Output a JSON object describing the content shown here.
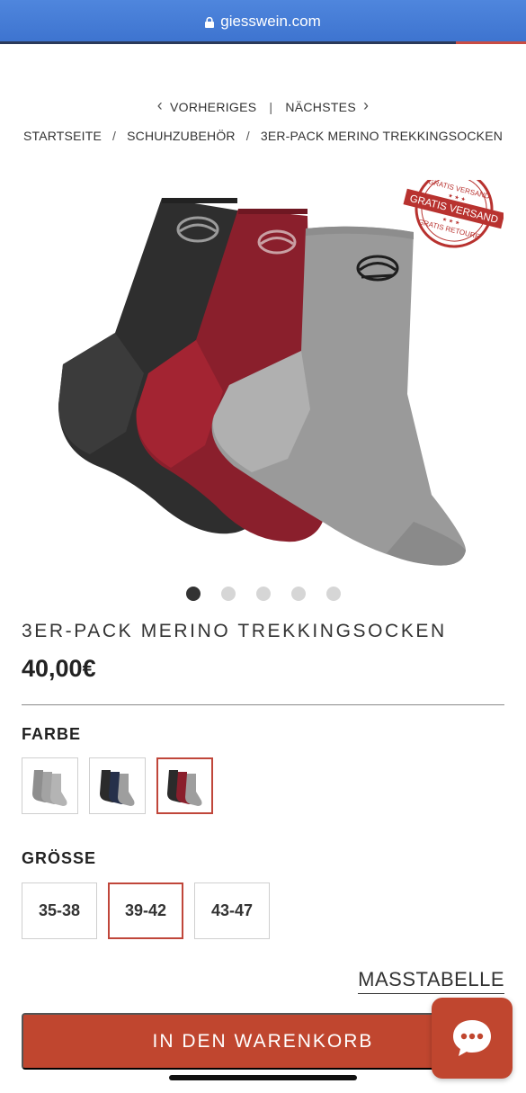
{
  "browser": {
    "url": "giesswein.com"
  },
  "nav": {
    "prev_label": "VORHERIGES",
    "separator": "|",
    "next_label": "NÄCHSTES"
  },
  "breadcrumb": {
    "items": [
      "STARTSEITE",
      "SCHUHZUBEHÖR",
      "3ER-PACK MERINO TREKKINGSOCKEN"
    ],
    "separator": "/"
  },
  "badge": {
    "top_text": "GRATIS VERSAND",
    "band_text": "GRATIS VERSAND",
    "bottom_text": "GRATIS RETOURE"
  },
  "gallery": {
    "image_count": 5,
    "active_index": 0
  },
  "product": {
    "title": "3ER-PACK MERINO TREKKINGSOCKEN",
    "price": "40,00€"
  },
  "color": {
    "label": "FARBE",
    "options": [
      "grey-pack",
      "black-navy-grey-pack",
      "black-red-grey-pack"
    ],
    "selected_index": 2
  },
  "size": {
    "label": "GRÖSSE",
    "options": [
      "35-38",
      "39-42",
      "43-47"
    ],
    "selected_index": 1
  },
  "size_chart_label": "MASSTABELLE",
  "cart_button_label": "IN DEN WARENKORB",
  "colors": {
    "accent": "#c0462f",
    "browser_bar": "#4f86dd",
    "sock_black": "#2e2e2e",
    "sock_red": "#8a1f2c",
    "sock_grey": "#9a9a9a"
  }
}
